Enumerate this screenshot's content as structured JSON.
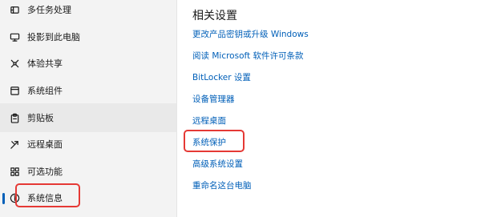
{
  "sidebar": {
    "items": [
      {
        "label": "多任务处理",
        "icon": "multitask-icon"
      },
      {
        "label": "投影到此电脑",
        "icon": "project-to-pc-icon"
      },
      {
        "label": "体验共享",
        "icon": "shared-experiences-icon"
      },
      {
        "label": "系统组件",
        "icon": "system-components-icon"
      },
      {
        "label": "剪贴板",
        "icon": "clipboard-icon"
      },
      {
        "label": "远程桌面",
        "icon": "remote-desktop-icon"
      },
      {
        "label": "可选功能",
        "icon": "optional-features-icon"
      },
      {
        "label": "系统信息",
        "icon": "system-info-icon"
      }
    ],
    "selected_label": "剪贴板",
    "accent_color": "#005fb8"
  },
  "related": {
    "title": "相关设置",
    "links": [
      "更改产品密钥或升级 Windows",
      "阅读 Microsoft 软件许可条款",
      "BitLocker 设置",
      "设备管理器",
      "远程桌面",
      "系统保护",
      "高级系统设置",
      "重命名这台电脑"
    ],
    "link_color": "#005fb8"
  },
  "annotations": {
    "highlight_color": "#e53935",
    "highlighted": [
      "系统信息",
      "系统保护"
    ]
  }
}
